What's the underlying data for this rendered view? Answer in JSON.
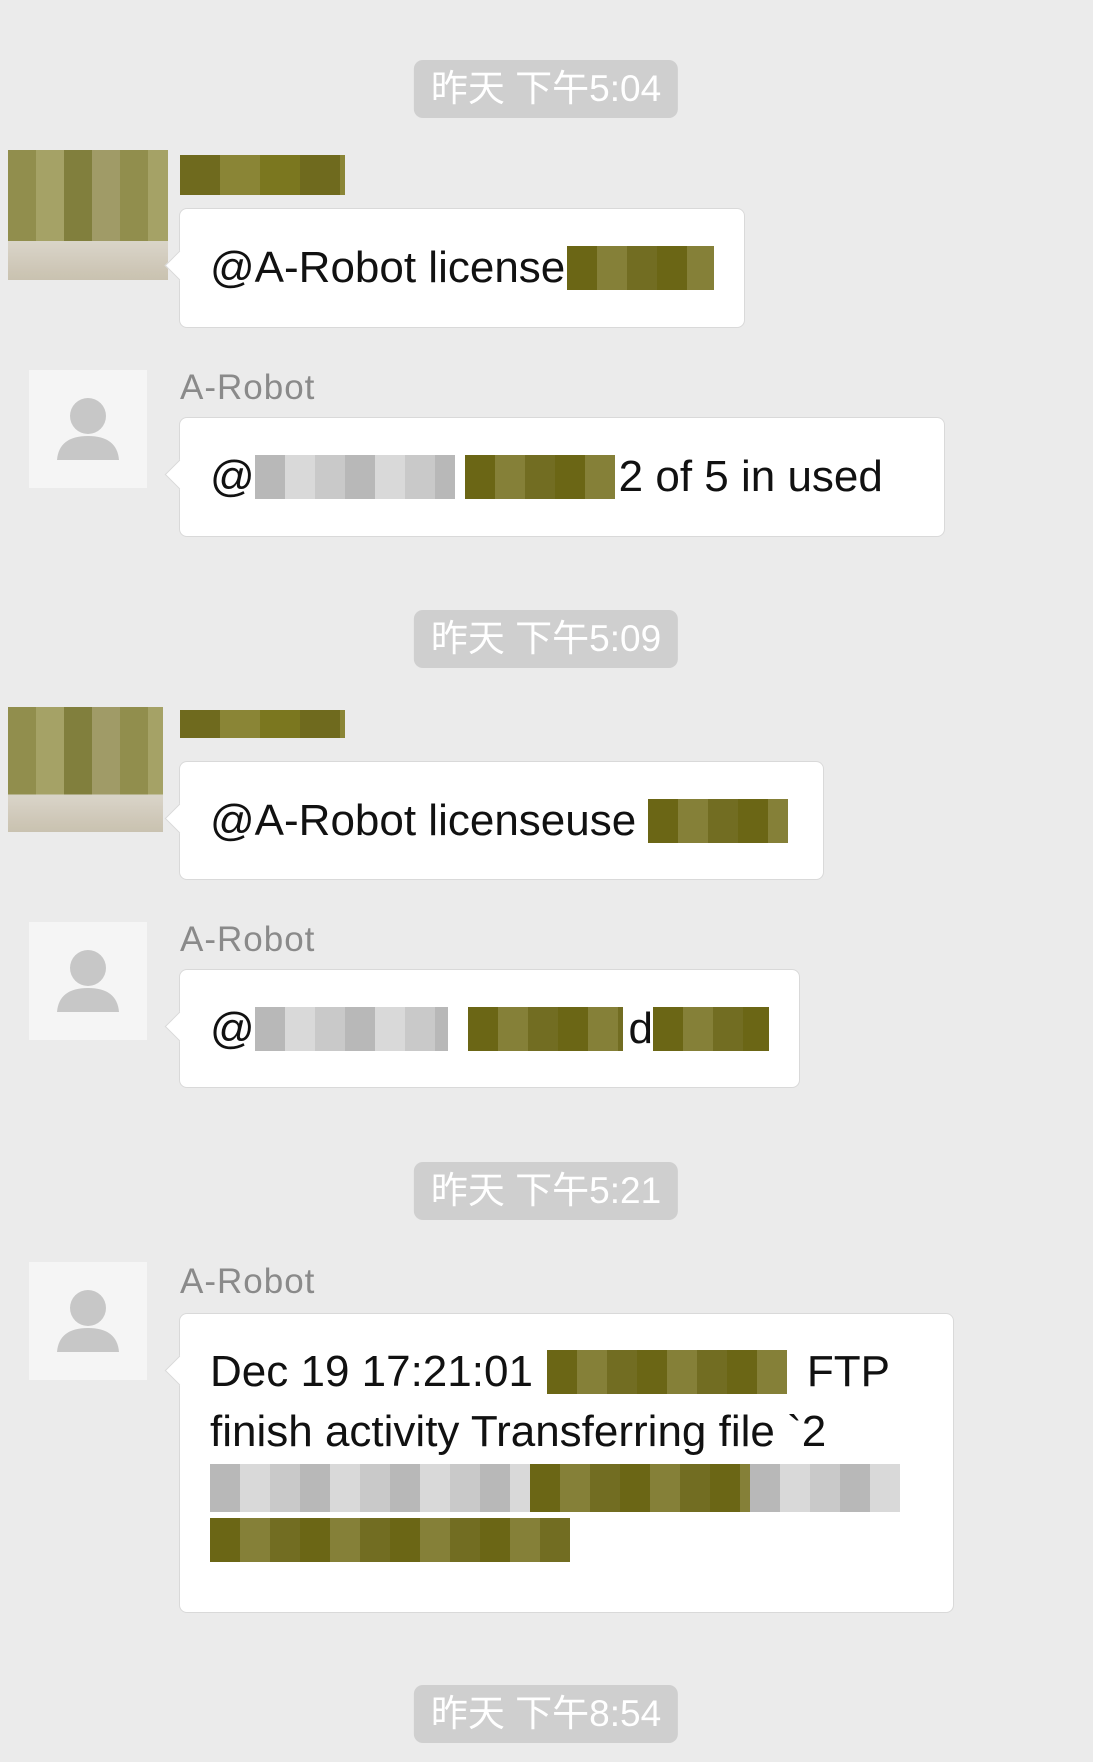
{
  "timestamps": [
    "昨天 下午5:04",
    "昨天 下午5:09",
    "昨天 下午5:21",
    "昨天 下午8:54"
  ],
  "robot_name": "A-Robot",
  "messages": {
    "m1": {
      "prefix": "@A-Robot license"
    },
    "m2": {
      "prefix": "@",
      "suffix": "2 of 5 in used"
    },
    "m3": {
      "prefix": "@A-Robot licenseuse"
    },
    "m4": {
      "prefix": "@",
      "middle": "d"
    },
    "m5": {
      "line1_prefix": "Dec 19 17:21:01",
      "line1_suffix": "FTP",
      "line2": "finish activity Transferring file `2"
    }
  },
  "icons": {
    "avatar": "person-icon"
  },
  "colors": {
    "background": "#ebebeb",
    "timestamp_bg": "#cfcfcf",
    "bubble_bg": "#ffffff",
    "name_text": "#8a8a8a"
  }
}
